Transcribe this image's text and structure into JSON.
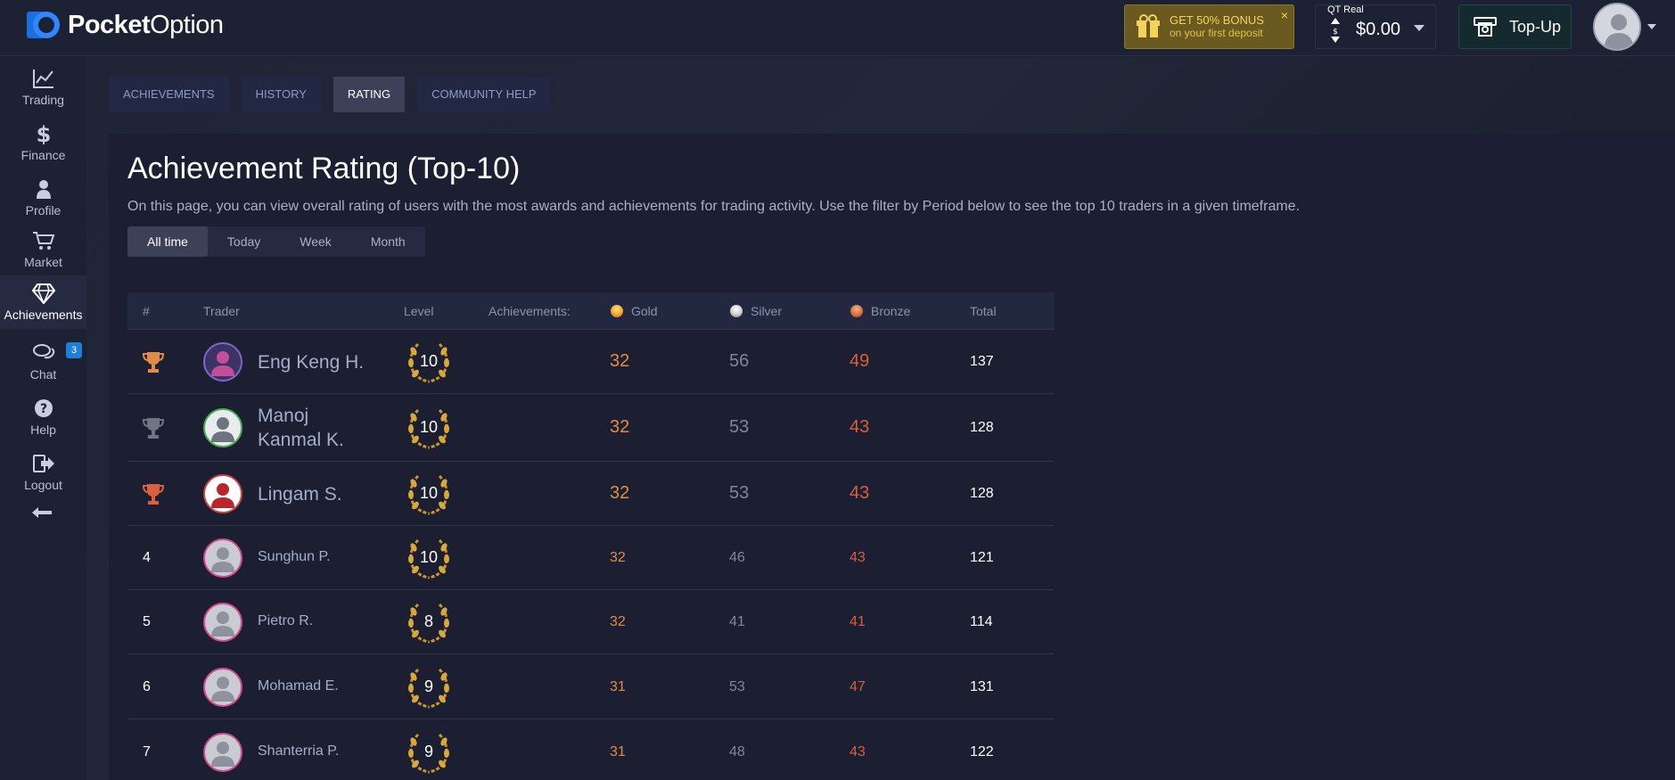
{
  "header": {
    "brand_bold": "Pocket",
    "brand_thin": "Option",
    "bonus_title": "GET 50% BONUS",
    "bonus_sub": "on your first deposit",
    "bonus_close": "×",
    "account_label": "QT Real",
    "balance": "$0.00",
    "topup_label": "Top-Up"
  },
  "sidebar": {
    "items": [
      {
        "label": "Trading",
        "icon": "chart-line-icon"
      },
      {
        "label": "Finance",
        "icon": "dollar-icon"
      },
      {
        "label": "Profile",
        "icon": "user-icon"
      },
      {
        "label": "Market",
        "icon": "cart-icon"
      },
      {
        "label": "Achievements",
        "icon": "diamond-icon",
        "active": true
      },
      {
        "label": "Chat",
        "icon": "chat-icon",
        "badge": "3"
      },
      {
        "label": "Help",
        "icon": "help-icon"
      },
      {
        "label": "Logout",
        "icon": "logout-icon"
      }
    ],
    "collapse_icon": "arrow-left-icon"
  },
  "tabs": [
    {
      "label": "ACHIEVEMENTS"
    },
    {
      "label": "HISTORY"
    },
    {
      "label": "RATING",
      "active": true
    },
    {
      "label": "COMMUNITY HELP"
    }
  ],
  "page": {
    "title": "Achievement Rating (Top-10)",
    "description": "On this page, you can view overall rating of users with the most awards and achievements for trading activity. Use the filter by Period below to see the top 10 traders in a given timeframe."
  },
  "period": {
    "options": [
      "All time",
      "Today",
      "Week",
      "Month"
    ],
    "selected": "All time"
  },
  "table": {
    "headers": {
      "rank": "#",
      "trader": "Trader",
      "level": "Level",
      "achievements": "Achievements:",
      "gold": "Gold",
      "silver": "Silver",
      "bronze": "Bronze",
      "total": "Total"
    },
    "rows": [
      {
        "rank": "1",
        "trophy": "gold",
        "name_lines": [
          "Eng Keng H."
        ],
        "level": "10",
        "gold": "32",
        "silver": "56",
        "bronze": "49",
        "total": "137"
      },
      {
        "rank": "2",
        "trophy": "silver",
        "name_lines": [
          "Manoj",
          "Kanmal K."
        ],
        "level": "10",
        "gold": "32",
        "silver": "53",
        "bronze": "43",
        "total": "128"
      },
      {
        "rank": "3",
        "trophy": "bronze",
        "name_lines": [
          "Lingam S."
        ],
        "level": "10",
        "gold": "32",
        "silver": "53",
        "bronze": "43",
        "total": "128"
      },
      {
        "rank": "4",
        "name_lines": [
          "Sunghun P."
        ],
        "level": "10",
        "gold": "32",
        "silver": "46",
        "bronze": "43",
        "total": "121"
      },
      {
        "rank": "5",
        "name_lines": [
          "Pietro R."
        ],
        "level": "8",
        "gold": "32",
        "silver": "41",
        "bronze": "41",
        "total": "114"
      },
      {
        "rank": "6",
        "name_lines": [
          "Mohamad E."
        ],
        "level": "9",
        "gold": "31",
        "silver": "53",
        "bronze": "47",
        "total": "131"
      },
      {
        "rank": "7",
        "name_lines": [
          "Shanterria P."
        ],
        "level": "9",
        "gold": "31",
        "silver": "48",
        "bronze": "43",
        "total": "122"
      }
    ]
  },
  "colors": {
    "gold": "#e08c45",
    "silver": "#80869a",
    "bronze": "#d8603c",
    "accent_blue": "#1e7fd6"
  }
}
